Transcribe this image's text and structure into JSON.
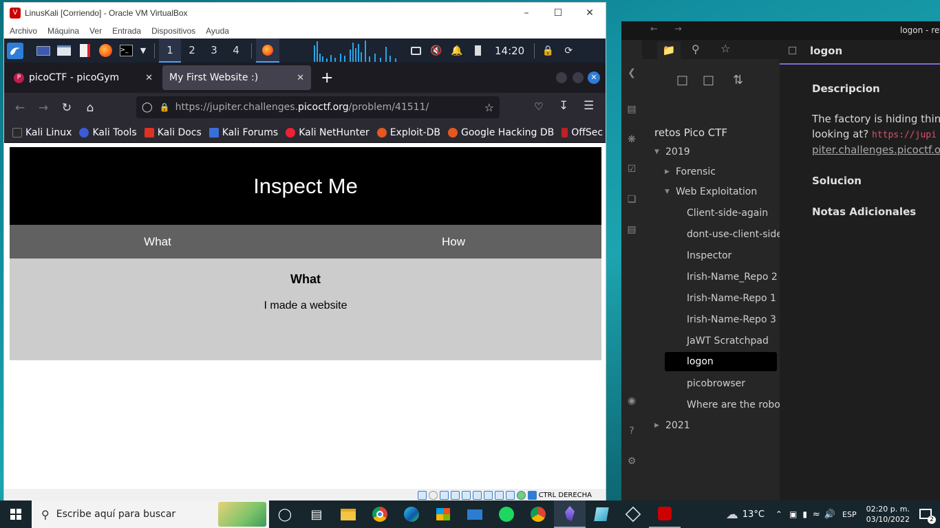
{
  "vbox": {
    "title": "LinusKali [Corriendo] - Oracle VM VirtualBox",
    "menu": [
      "Archivo",
      "Máquina",
      "Ver",
      "Entrada",
      "Dispositivos",
      "Ayuda"
    ],
    "status_text": "CTRL DERECHA"
  },
  "kali_panel": {
    "workspaces": [
      "1",
      "2",
      "3",
      "4"
    ],
    "clock": "14:20"
  },
  "firefox": {
    "tabs": [
      {
        "title": "picoCTF - picoGym"
      },
      {
        "title": "My First Website :)"
      }
    ],
    "url": {
      "prefix": "https://jupiter.challenges.",
      "domain": "picoctf.org",
      "path": "/problem/41511/"
    },
    "bookmarks": [
      "Kali Linux",
      "Kali Tools",
      "Kali Docs",
      "Kali Forums",
      "Kali NetHunter",
      "Exploit-DB",
      "Google Hacking DB",
      "OffSec"
    ]
  },
  "website": {
    "header": "Inspect Me",
    "tabs": [
      "What",
      "How"
    ],
    "content_title": "What",
    "content_text": "I made a website"
  },
  "obsidian": {
    "window_title": "logon - retos",
    "vault": "retos Pico CTF",
    "tree": {
      "y2019": "2019",
      "forensic": "Forensic",
      "webexp": "Web Exploitation",
      "notes": [
        "Client-side-again",
        "dont-use-client-side",
        "Inspector",
        "Irish-Name_Repo 2",
        "Irish-Name-Repo 1",
        "Irish-Name-Repo 3",
        "JaWT Scratchpad",
        "logon",
        "picobrowser",
        "Where are the robots"
      ],
      "y2021": "2021"
    },
    "note": {
      "title": "logon",
      "h_desc": "Descripcion",
      "desc_line1": "The factory is hiding things",
      "desc_line2": "looking at?",
      "desc_code": "https://jupi",
      "desc_link": "piter.challenges.picoctf.org",
      "h_sol": "Solucion",
      "h_notes": "Notas Adicionales"
    }
  },
  "taskbar": {
    "search_placeholder": "Escribe aquí para buscar",
    "weather": "13°C",
    "lang": "ESP",
    "time": "02:20 p. m.",
    "date": "03/10/2022",
    "notif_count": "2"
  }
}
